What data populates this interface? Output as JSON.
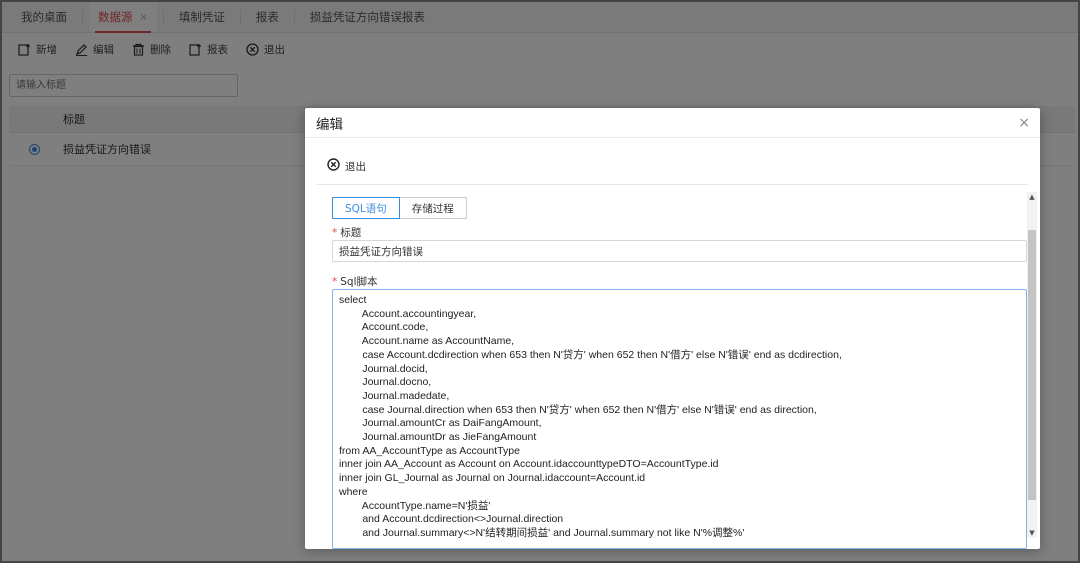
{
  "tabs": [
    {
      "label": "我的桌面"
    },
    {
      "label": "数据源"
    },
    {
      "label": "填制凭证"
    },
    {
      "label": "报表"
    },
    {
      "label": "损益凭证方向错误报表"
    }
  ],
  "tab_close": "×",
  "toolbar": {
    "add": "新增",
    "edit": "编辑",
    "delete": "删除",
    "report": "报表",
    "exit": "退出"
  },
  "search": {
    "placeholder": "请输入标题"
  },
  "grid": {
    "header_title": "标题",
    "rows": [
      {
        "title": "损益凭证方向错误"
      }
    ]
  },
  "modal": {
    "title": "编辑",
    "close": "×",
    "exit": "退出",
    "tab_sql": "SQL语句",
    "tab_proc": "存储过程",
    "title_label": "标题",
    "title_value": "损益凭证方向错误",
    "script_label": "Sql脚本",
    "required_mark": "*",
    "sql_lines": [
      "select",
      "        Account.accountingyear,",
      "        Account.code,",
      "        Account.name as AccountName,",
      "        case Account.dcdirection when 653 then N'贷方' when 652 then N'借方' else N'错误' end as dcdirection,",
      "        Journal.docid,",
      "        Journal.docno,",
      "        Journal.madedate,",
      "        case Journal.direction when 653 then N'贷方' when 652 then N'借方' else N'错误' end as direction,",
      "        Journal.amountCr as DaiFangAmount,",
      "        Journal.amountDr as JieFangAmount",
      "from AA_AccountType as AccountType",
      "inner join AA_Account as Account on Account.idaccounttypeDTO=AccountType.id",
      "inner join GL_Journal as Journal on Journal.idaccount=Account.id",
      "where",
      "        AccountType.name=N'损益'",
      "        and Account.dcdirection<>Journal.direction",
      "        and Journal.summary<>N'结转期间损益' and Journal.summary not like N'%调整%'"
    ]
  },
  "colors": {
    "accent": "#e5484d",
    "primary": "#3b8de3"
  }
}
